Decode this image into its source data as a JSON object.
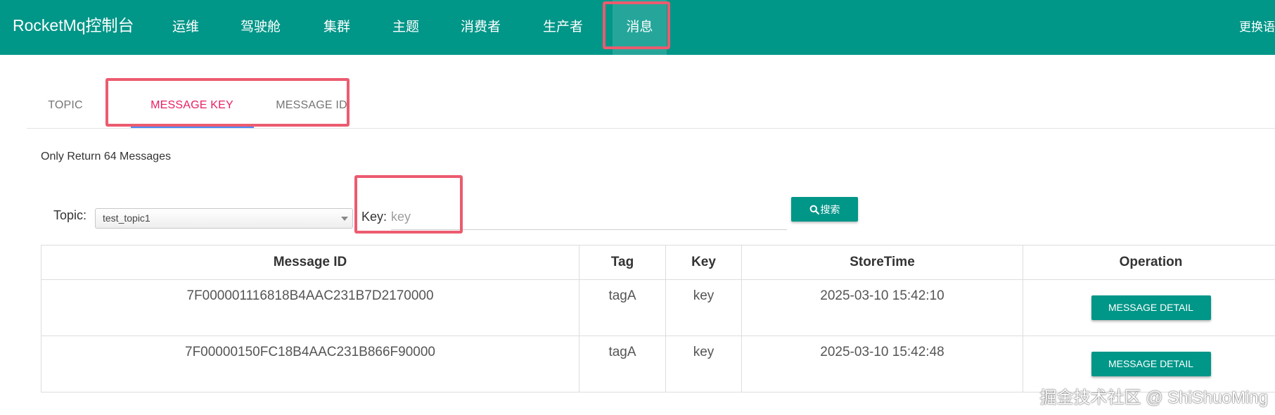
{
  "app": {
    "brand": "RocketMq控制台",
    "nav": [
      "运维",
      "驾驶舱",
      "集群",
      "主题",
      "消费者",
      "生产者",
      "消息"
    ],
    "nav_active": "消息",
    "right_link": "更换语"
  },
  "tabs": [
    {
      "label": "TOPIC",
      "active": false
    },
    {
      "label": "MESSAGE KEY",
      "active": true
    },
    {
      "label": "MESSAGE ID",
      "active": false
    }
  ],
  "notice": "Only Return 64 Messages",
  "search": {
    "topic_label": "Topic:",
    "topic_value": "test_topic1",
    "key_label": "Key:",
    "key_placeholder": "key",
    "button_label": "搜索"
  },
  "table": {
    "headers": [
      "Message ID",
      "Tag",
      "Key",
      "StoreTime",
      "Operation"
    ],
    "rows": [
      {
        "message_id": "7F000001116818B4AAC231B7D2170000",
        "tag": "tagA",
        "key": "key",
        "store_time": "2025-03-10 15:42:10",
        "action": "MESSAGE DETAIL"
      },
      {
        "message_id": "7F00000150FC18B4AAC231B866F90000",
        "tag": "tagA",
        "key": "key",
        "store_time": "2025-03-10 15:42:48",
        "action": "MESSAGE DETAIL"
      }
    ]
  },
  "watermark": "掘金技术社区 @ ShiShuoMing",
  "colors": {
    "primary": "#009688",
    "active_tab": "#e91e63",
    "highlight": "#ec5b6f"
  }
}
